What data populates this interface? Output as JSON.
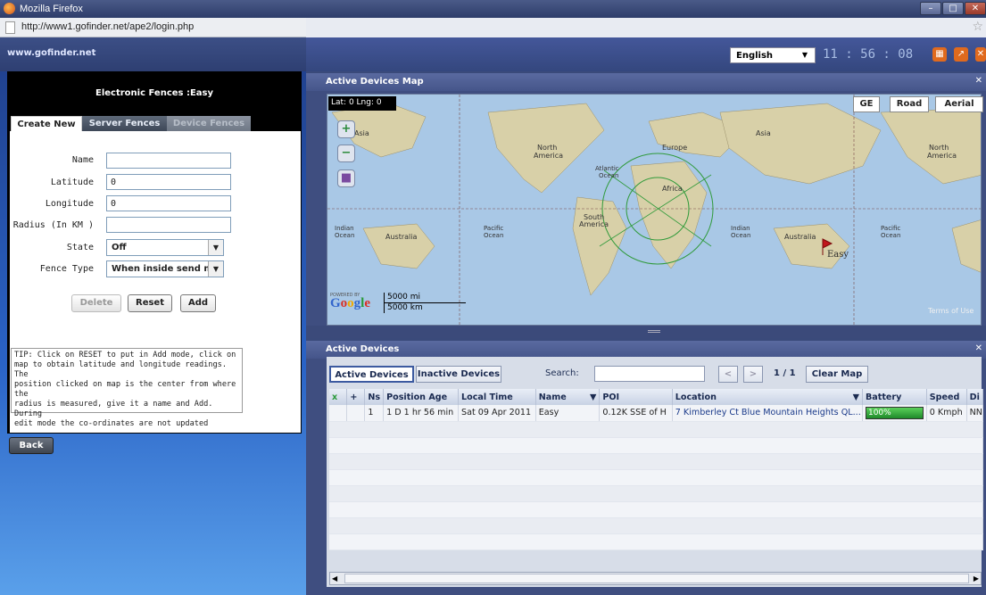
{
  "window": {
    "title": "Mozilla Firefox",
    "url": "http://www1.gofinder.net/ape2/login.php"
  },
  "site": {
    "name": "www.gofinder.net"
  },
  "fence_panel": {
    "title": "Electronic Fences :Easy",
    "tabs": [
      "Create New",
      "Server Fences",
      "Device Fences"
    ],
    "fields": {
      "name": {
        "label": "Name",
        "value": ""
      },
      "latitude": {
        "label": "Latitude",
        "value": "0"
      },
      "longitude": {
        "label": "Longitude",
        "value": "0"
      },
      "radius": {
        "label": "Radius (In KM )",
        "value": ""
      },
      "state": {
        "label": "State",
        "value": "Off"
      },
      "fence_type": {
        "label": "Fence Type",
        "value": "When inside send m"
      }
    },
    "buttons": {
      "delete": "Delete",
      "reset": "Reset",
      "add": "Add",
      "back": "Back"
    },
    "tip_lines": [
      "TIP: Click on RESET to put in Add mode, click on",
      "map to obtain latitude and longitude readings. The",
      "position clicked on map is the center from where the",
      "radius is measured, give it a name and Add. During",
      "edit mode the co-ordinates are not updated"
    ]
  },
  "header": {
    "language": "English",
    "clock": "11 : 56 : 08"
  },
  "map_panel": {
    "title": "Active Devices Map",
    "latlng": "Lat: 0  Lng: 0",
    "view_buttons": [
      "GE",
      "Road",
      "Aerial"
    ],
    "labels": {
      "asia": "Asia",
      "asia2": "Asia",
      "north_america": "North\nAmerica",
      "europe": "Europe",
      "atlantic": "Atlantic\nOcean",
      "africa": "Africa",
      "south_america": "South\nAmerica",
      "pacific": "Pacific\nOcean",
      "indian": "Indian\nOcean",
      "australia": "Australia",
      "marker": "Easy"
    },
    "scale": {
      "mi": "5000 mi",
      "km": "5000 km"
    },
    "powered_by": "POWERED BY",
    "google": "Google",
    "terms": "Terms of Use"
  },
  "devices_panel": {
    "title": "Active Devices",
    "tabs": [
      "Active Devices",
      "Inactive Devices"
    ],
    "search_label": "Search:",
    "pager": "1 / 1",
    "clear_map": "Clear Map",
    "columns": [
      "x",
      "+",
      "Ns",
      "Position Age",
      "Local Time",
      "Name",
      "POI",
      "Location",
      "Battery",
      "Speed",
      "Di"
    ],
    "rows": [
      {
        "ns": "1",
        "age": "1 D 1 hr 56 min",
        "time": "Sat 09 Apr 2011",
        "name": "Easy",
        "poi": "0.12K SSE of H",
        "location": "7 Kimberley Ct Blue Mountain Heights QL...",
        "battery": "100%",
        "battery_level": 1.0,
        "speed": "0 Kmph",
        "di": "NN"
      }
    ]
  },
  "colors": {
    "accent": "#44579a",
    "battery": "#1f9a2a"
  }
}
